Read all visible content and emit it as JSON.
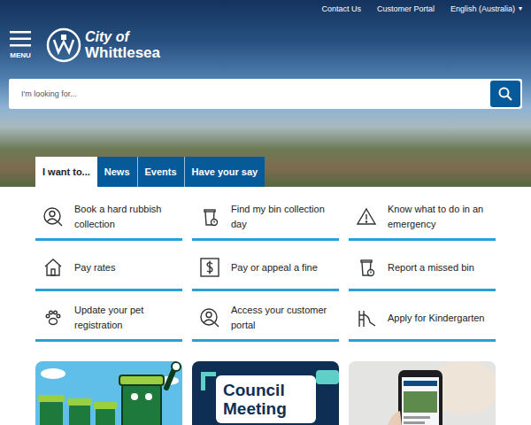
{
  "top_links": [
    "Contact Us",
    "Customer Portal"
  ],
  "language": {
    "label": "English (Australia)",
    "caret": "▾"
  },
  "menu": {
    "label": "MENU"
  },
  "logo": {
    "line1": "City of",
    "line2": "Whittlesea"
  },
  "search": {
    "placeholder": "I'm looking for..."
  },
  "tabs": [
    {
      "label": "I want to...",
      "selected": true
    },
    {
      "label": "News",
      "selected": false
    },
    {
      "label": "Events",
      "selected": false
    },
    {
      "label": "Have your say",
      "selected": false
    }
  ],
  "quick_links": [
    {
      "label": "Book a hard rubbish collection"
    },
    {
      "label": "Find my bin collection day"
    },
    {
      "label": "Know what to do in an emergency"
    },
    {
      "label": "Pay rates"
    },
    {
      "label": "Pay or appeal a fine"
    },
    {
      "label": "Report a missed bin"
    },
    {
      "label": "Update your pet registration"
    },
    {
      "label": "Access your customer portal"
    },
    {
      "label": "Apply for Kindergarten"
    }
  ],
  "cards": [
    {
      "kind": "illustration",
      "title": ""
    },
    {
      "kind": "graphic",
      "title": "Council Meeting"
    },
    {
      "kind": "photo",
      "title": ""
    }
  ]
}
